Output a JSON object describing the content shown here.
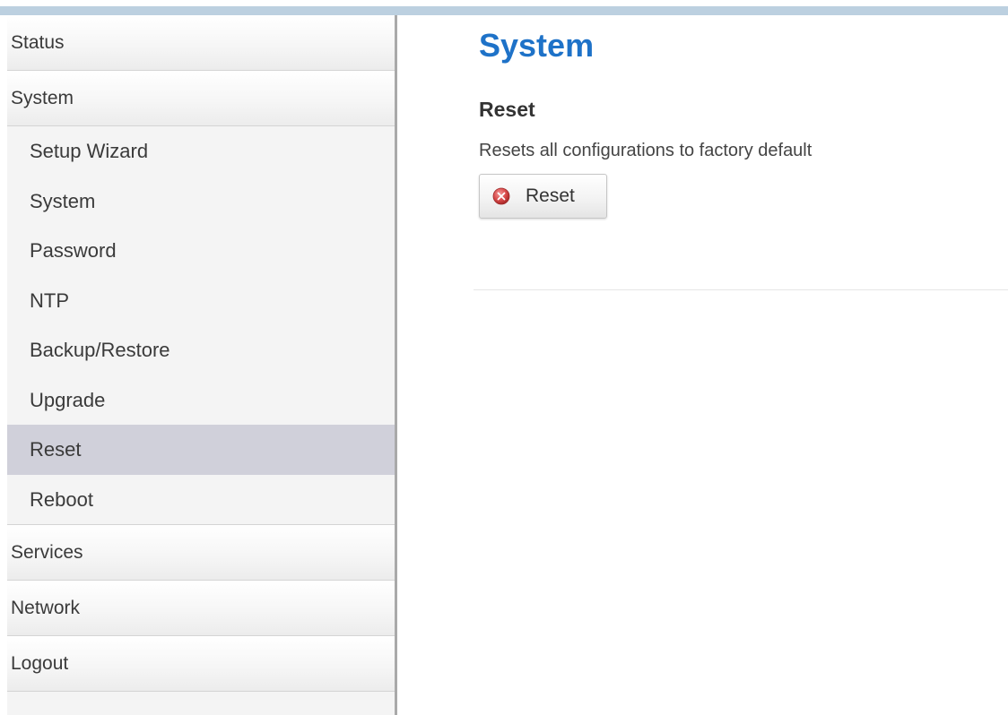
{
  "sidebar": {
    "top_items": [
      {
        "label": "Status"
      },
      {
        "label": "System"
      }
    ],
    "system_submenu": [
      {
        "label": "Setup Wizard"
      },
      {
        "label": "System"
      },
      {
        "label": "Password"
      },
      {
        "label": "NTP"
      },
      {
        "label": "Backup/Restore"
      },
      {
        "label": "Upgrade"
      },
      {
        "label": "Reset",
        "active": true
      },
      {
        "label": "Reboot"
      }
    ],
    "bottom_items": [
      {
        "label": "Services"
      },
      {
        "label": "Network"
      },
      {
        "label": "Logout"
      }
    ]
  },
  "main": {
    "page_title": "System",
    "section_title": "Reset",
    "description": "Resets all configurations to factory default",
    "reset_button_label": "Reset",
    "reset_button_icon": "cross-circle-icon"
  },
  "colors": {
    "title_blue": "#1e72c8",
    "active_item_bg": "#d0d0da",
    "top_strip": "#bcd0e0",
    "icon_red": "#d94b4b"
  }
}
